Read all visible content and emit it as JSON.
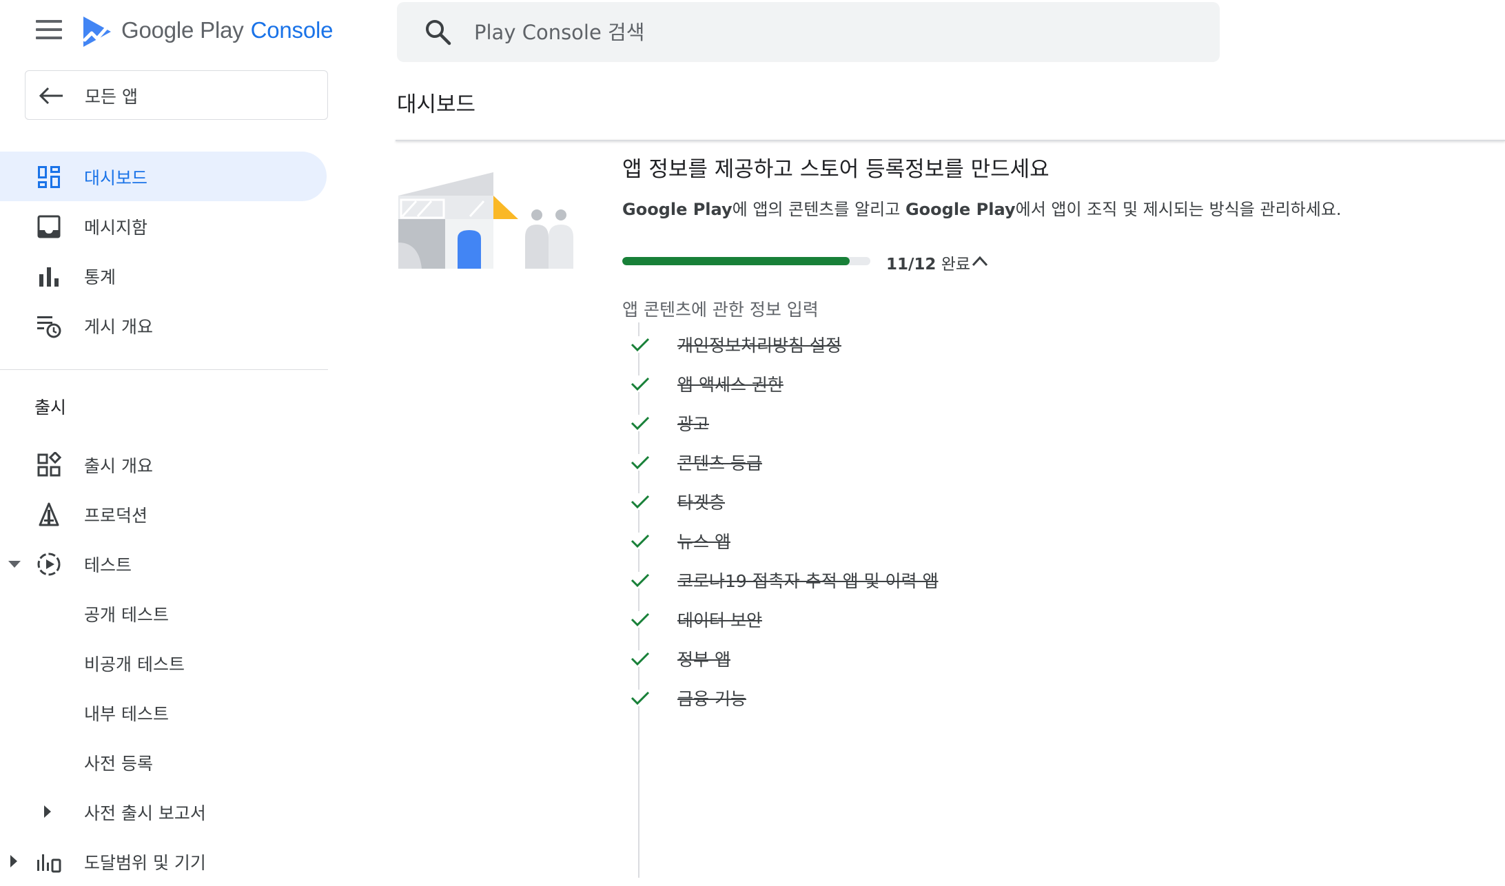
{
  "app": {
    "logo_google": "Google Play",
    "logo_console": "Console",
    "brand_color": "#1a73e8"
  },
  "sidebar": {
    "back_label": "모든 앱",
    "items": [
      {
        "label": "대시보드",
        "icon": "dashboard-icon",
        "active": true
      },
      {
        "label": "메시지함",
        "icon": "inbox-icon"
      },
      {
        "label": "통계",
        "icon": "bar-chart-icon"
      },
      {
        "label": "게시 개요",
        "icon": "publishing-overview-icon"
      }
    ],
    "release_section_title": "출시",
    "release_items": [
      {
        "label": "출시 개요",
        "icon": "releases-overview-icon"
      },
      {
        "label": "프로덕션",
        "icon": "production-icon"
      },
      {
        "label": "테스트",
        "icon": "testing-icon",
        "expanded": true
      },
      {
        "label": "공개 테스트"
      },
      {
        "label": "비공개 테스트"
      },
      {
        "label": "내부 테스트"
      },
      {
        "label": "사전 등록"
      },
      {
        "label": "사전 출시 보고서",
        "collapsed": true
      },
      {
        "label": "도달범위 및 기기",
        "icon": "reach-devices-icon",
        "collapsed": true
      }
    ]
  },
  "search": {
    "placeholder": "Play Console 검색"
  },
  "main": {
    "page_title": "대시보드",
    "card": {
      "title": "앱 정보를 제공하고 스토어 등록정보를 만드세요",
      "desc_brand1": "Google Play",
      "desc_part1": "에 앱의 콘텐츠를 알리고 ",
      "desc_brand2": "Google Play",
      "desc_part2": "에서 앱이 조직 및 제시되는 방식을 관리하세요.",
      "progress_fraction": 0.917,
      "progress_count": "11/12",
      "progress_suffix": " 완료",
      "progress_color": "#188038",
      "list_heading": "앱 콘텐츠에 관한 정보 입력",
      "tasks": [
        "개인정보처리방침 설정",
        "앱 액세스 권한",
        "광고",
        "콘텐츠 등급",
        "타겟층",
        "뉴스 앱",
        "코로나19 접촉자 추적 앱 및 이력 앱",
        "데이터 보안",
        "정부 앱",
        "금융 기능"
      ]
    }
  }
}
